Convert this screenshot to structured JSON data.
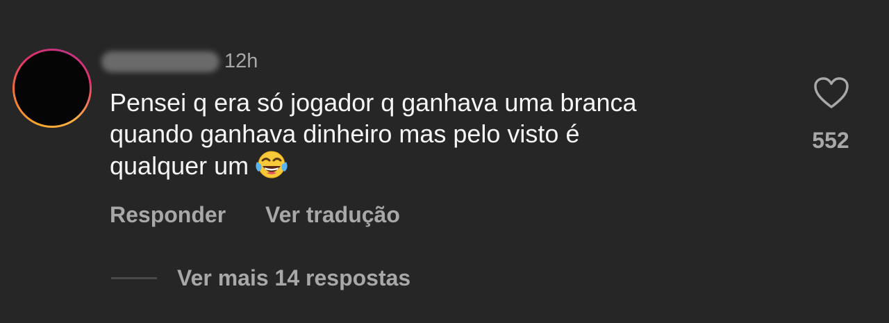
{
  "comment": {
    "author_avatar": "avatar (story ring)",
    "time": "12h",
    "text_lines": [
      "Pensei q era só jogador q ganhava uma branca",
      "quando ganhava dinheiro mas pelo visto é",
      "qualquer um"
    ],
    "emoji": "face-with-tears-of-joy",
    "actions": {
      "reply": "Responder",
      "translate": "Ver tradução"
    },
    "likes": {
      "icon": "heart-outline-icon",
      "count": "552"
    },
    "more_replies": "Ver mais 14 respostas"
  },
  "colors": {
    "background": "#262626",
    "primary_text": "#f5f5f5",
    "secondary_text": "#a8a8a8"
  }
}
